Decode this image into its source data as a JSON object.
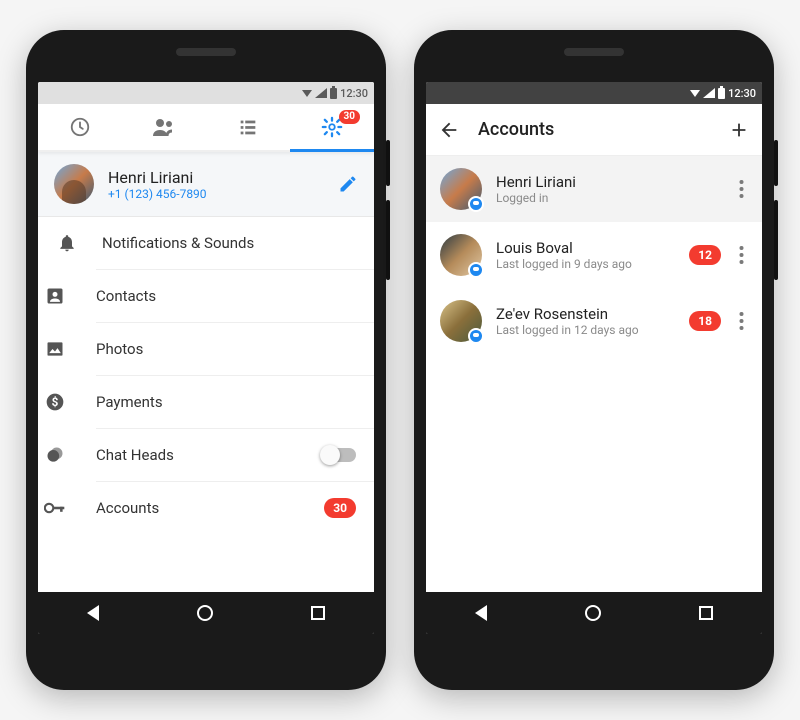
{
  "status": {
    "time": "12:30"
  },
  "colors": {
    "accent": "#1e88f0",
    "danger": "#f33b2f"
  },
  "tabs": {
    "badge": "30",
    "icons": [
      "clock-icon",
      "people-icon",
      "list-icon",
      "gear-icon"
    ]
  },
  "profile": {
    "name": "Henri Liriani",
    "phone": "+1 (123) 456-7890"
  },
  "settings": [
    {
      "icon": "bell-icon",
      "label": "Notifications & Sounds"
    },
    {
      "icon": "contact-icon",
      "label": "Contacts"
    },
    {
      "icon": "image-icon",
      "label": "Photos"
    },
    {
      "icon": "dollar-icon",
      "label": "Payments"
    },
    {
      "icon": "chathead-icon",
      "label": "Chat Heads",
      "toggle": false
    },
    {
      "icon": "key-icon",
      "label": "Accounts",
      "badge": "30"
    }
  ],
  "accounts_screen": {
    "title": "Accounts",
    "rows": [
      {
        "name": "Henri Liriani",
        "sub": "Logged in",
        "selected": true
      },
      {
        "name": "Louis Boval",
        "sub": "Last logged in 9 days ago",
        "badge": "12"
      },
      {
        "name": "Ze'ev Rosenstein",
        "sub": "Last logged in 12 days ago",
        "badge": "18"
      }
    ]
  }
}
